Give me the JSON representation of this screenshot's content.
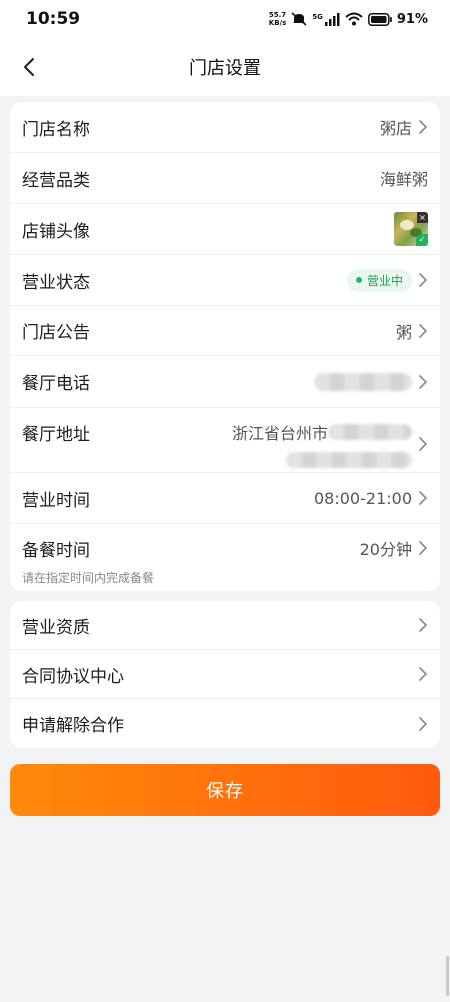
{
  "status_bar": {
    "time": "10:59",
    "net_speed_value": "55.7",
    "net_speed_unit": "KB/s",
    "signal_label": "5G",
    "battery": "91%"
  },
  "nav": {
    "title": "门店设置"
  },
  "settings": {
    "name": {
      "label": "门店名称",
      "value": "粥店"
    },
    "category": {
      "label": "经营品类",
      "value": "海鲜粥"
    },
    "avatar": {
      "label": "店铺头像"
    },
    "state": {
      "label": "营业状态",
      "badge": "营业中"
    },
    "notice": {
      "label": "门店公告",
      "value": "粥"
    },
    "phone": {
      "label": "餐厅电话"
    },
    "address": {
      "label": "餐厅地址",
      "value_prefix": "浙江省台州市"
    },
    "hours": {
      "label": "营业时间",
      "value": "08:00-21:00"
    },
    "prep": {
      "label": "备餐时间",
      "value": "20分钟",
      "hint": "请在指定时间内完成备餐"
    }
  },
  "links": [
    {
      "label": "营业资质"
    },
    {
      "label": "合同协议中心"
    },
    {
      "label": "申请解除合作"
    }
  ],
  "save_button": {
    "label": "保存"
  },
  "colors": {
    "accent_start": "#ff8a0a",
    "accent_end": "#ff5a0d",
    "status_green": "#27b463"
  }
}
